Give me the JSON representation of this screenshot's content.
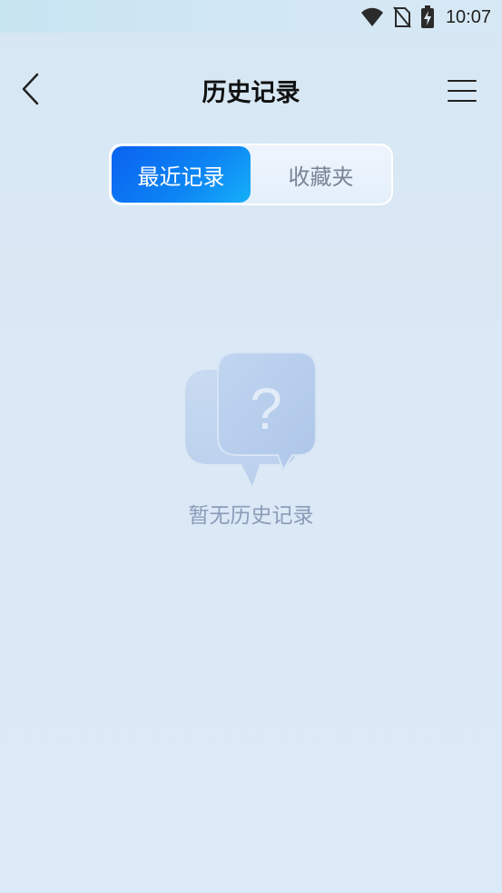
{
  "status_bar": {
    "time": "10:07",
    "icons": [
      "wifi-icon",
      "no-sim-icon",
      "battery-charging-icon"
    ]
  },
  "header": {
    "title": "历史记录",
    "back_icon": "chevron-left-icon",
    "menu_icon": "hamburger-menu-icon"
  },
  "tabs": [
    {
      "label": "最近记录",
      "active": true
    },
    {
      "label": "收藏夹",
      "active": false
    }
  ],
  "empty_state": {
    "icon": "question-chat-bubbles-icon",
    "glyph": "?",
    "message": "暂无历史记录"
  },
  "colors": {
    "accent": "#0a62f0",
    "accent_end": "#14b0f8",
    "muted_text": "#8b9cb9"
  }
}
